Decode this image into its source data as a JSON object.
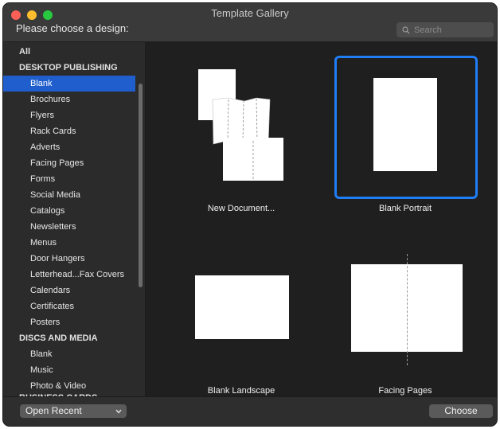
{
  "window": {
    "title": "Template Gallery"
  },
  "header": {
    "prompt": "Please choose a design:",
    "search_placeholder": "Search"
  },
  "sidebar": {
    "items": [
      {
        "label": "All",
        "kind": "cat"
      },
      {
        "label": "DESKTOP PUBLISHING",
        "kind": "cat"
      },
      {
        "label": "Blank",
        "kind": "sub",
        "selected": true
      },
      {
        "label": "Brochures",
        "kind": "sub"
      },
      {
        "label": "Flyers",
        "kind": "sub"
      },
      {
        "label": "Rack Cards",
        "kind": "sub"
      },
      {
        "label": "Adverts",
        "kind": "sub"
      },
      {
        "label": "Facing Pages",
        "kind": "sub"
      },
      {
        "label": "Forms",
        "kind": "sub"
      },
      {
        "label": "Social Media",
        "kind": "sub"
      },
      {
        "label": "Catalogs",
        "kind": "sub"
      },
      {
        "label": "Newsletters",
        "kind": "sub"
      },
      {
        "label": "Menus",
        "kind": "sub"
      },
      {
        "label": "Door Hangers",
        "kind": "sub"
      },
      {
        "label": "Letterhead...Fax Covers",
        "kind": "sub"
      },
      {
        "label": "Calendars",
        "kind": "sub"
      },
      {
        "label": "Certificates",
        "kind": "sub"
      },
      {
        "label": "Posters",
        "kind": "sub"
      },
      {
        "label": "DISCS AND MEDIA",
        "kind": "cat"
      },
      {
        "label": "Blank",
        "kind": "sub"
      },
      {
        "label": "Music",
        "kind": "sub"
      },
      {
        "label": "Photo & Video",
        "kind": "sub"
      },
      {
        "label": "BUSINESS CARDS",
        "kind": "cat"
      }
    ]
  },
  "templates": [
    {
      "label": "New Document..."
    },
    {
      "label": "Blank Portrait",
      "selected": true
    },
    {
      "label": "Blank Landscape"
    },
    {
      "label": "Facing Pages"
    }
  ],
  "footer": {
    "open_recent": "Open Recent",
    "choose": "Choose"
  },
  "colors": {
    "accent": "#1f7ef5",
    "selection": "#1f5ecc"
  }
}
